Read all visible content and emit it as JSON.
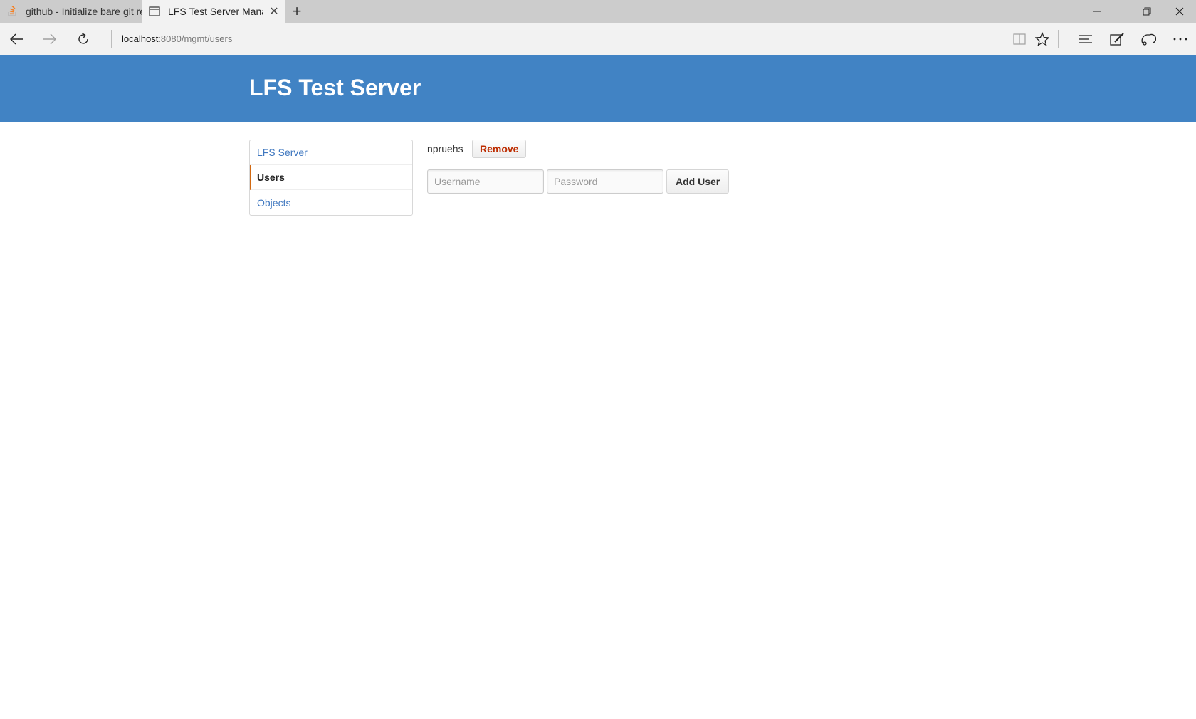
{
  "browser": {
    "tabs": [
      {
        "title": "github - Initialize bare git re",
        "active": false,
        "icon": "stackoverflow-icon"
      },
      {
        "title": "LFS Test Server Manage",
        "active": true,
        "icon": "page-icon"
      }
    ],
    "address": {
      "host": "localhost",
      "path": ":8080/mgmt/users"
    }
  },
  "page": {
    "title": "LFS Test Server",
    "header_color": "#4183c4"
  },
  "sidebar": {
    "items": [
      {
        "label": "LFS Server",
        "selected": false
      },
      {
        "label": "Users",
        "selected": true
      },
      {
        "label": "Objects",
        "selected": false
      }
    ]
  },
  "users": {
    "list": [
      {
        "name": "npruehs",
        "remove_label": "Remove"
      }
    ],
    "form": {
      "username_placeholder": "Username",
      "password_placeholder": "Password",
      "submit_label": "Add User"
    }
  }
}
